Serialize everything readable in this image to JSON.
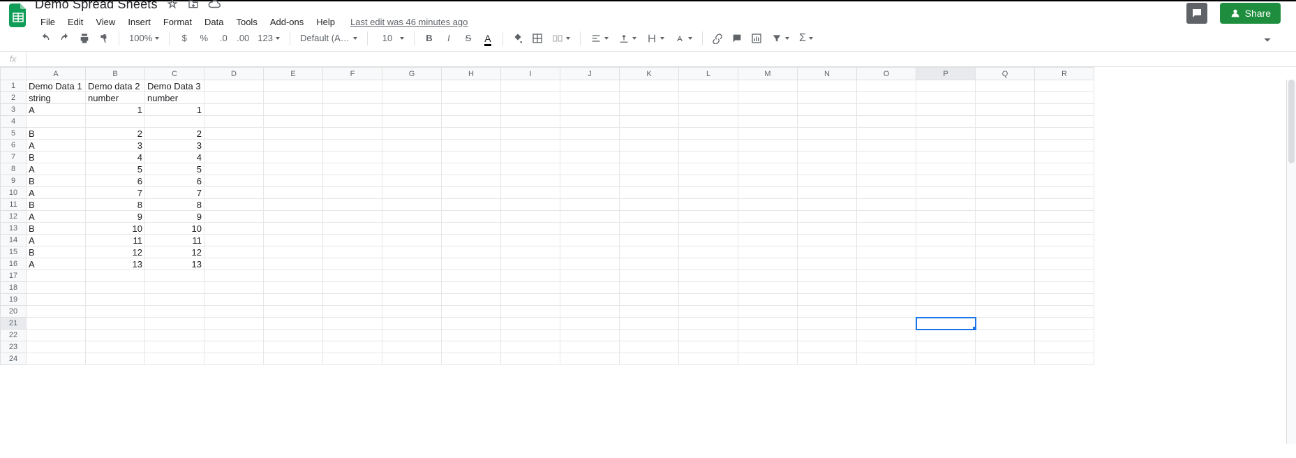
{
  "header": {
    "doc_title": "Demo Spread Sheets",
    "last_edit": "Last edit was 46 minutes ago",
    "share_label": "Share"
  },
  "menu": {
    "file": "File",
    "edit": "Edit",
    "view": "View",
    "insert": "Insert",
    "format": "Format",
    "data": "Data",
    "tools": "Tools",
    "addons": "Add-ons",
    "help": "Help"
  },
  "toolbar": {
    "zoom": "100%",
    "num_123": "123",
    "font_name": "Default (Ari...",
    "font_size": "10"
  },
  "fx": {
    "label": "fx",
    "value": ""
  },
  "grid": {
    "columns": [
      "A",
      "B",
      "C",
      "D",
      "E",
      "F",
      "G",
      "H",
      "I",
      "J",
      "K",
      "L",
      "M",
      "N",
      "O",
      "P",
      "Q",
      "R"
    ],
    "col_widths": {
      "default": 85,
      "A": 85,
      "B": 85,
      "C": 85
    },
    "total_rows": 24,
    "selected_col": "P",
    "selected_row": 21,
    "cells": {
      "1": {
        "A": "Demo Data 1",
        "B": "Demo data 2",
        "C": "Demo Data 3"
      },
      "2": {
        "A": "string",
        "B": "number",
        "C": "number"
      },
      "3": {
        "A": "A",
        "B": 1,
        "C": 1
      },
      "4": {},
      "5": {
        "A": "B",
        "B": 2,
        "C": 2
      },
      "6": {
        "A": "A",
        "B": 3,
        "C": 3
      },
      "7": {
        "A": "B",
        "B": 4,
        "C": 4
      },
      "8": {
        "A": "A",
        "B": 5,
        "C": 5
      },
      "9": {
        "A": "B",
        "B": 6,
        "C": 6
      },
      "10": {
        "A": "A",
        "B": 7,
        "C": 7
      },
      "11": {
        "A": "B",
        "B": 8,
        "C": 8
      },
      "12": {
        "A": "A",
        "B": 9,
        "C": 9
      },
      "13": {
        "A": "B",
        "B": 10,
        "C": 10
      },
      "14": {
        "A": "A",
        "B": 11,
        "C": 11
      },
      "15": {
        "A": "B",
        "B": 12,
        "C": 12
      },
      "16": {
        "A": "A",
        "B": 13,
        "C": 13
      }
    }
  }
}
